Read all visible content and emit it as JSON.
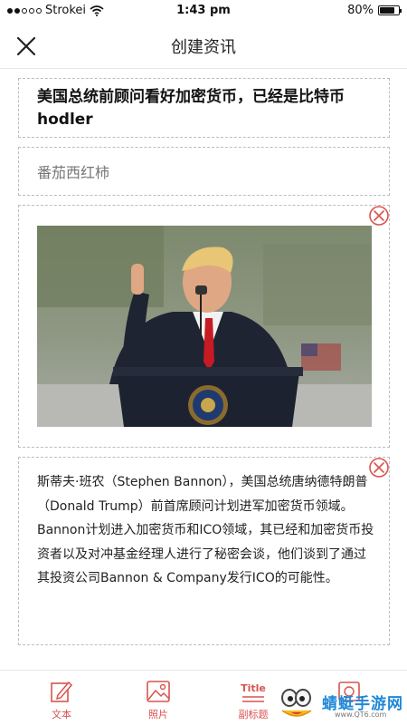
{
  "status_bar": {
    "carrier": "Strokei",
    "time": "1:43 pm",
    "battery": "80%",
    "battery_level": 0.8
  },
  "nav": {
    "title": "创建资讯",
    "close_icon": "close-icon"
  },
  "article": {
    "title": "美国总统前顾问看好加密货币，已经是比特币hodler",
    "subtitle": "番茄西红柿",
    "body": "斯蒂夫·班农（Stephen Bannon），美国总统唐纳德特朗普（Donald Trump）前首席顾问计划进军加密货币领域。Bannon计划进入加密货币和ICO领域，其已经和加密货币投资者以及对冲基金经理人进行了秘密会谈，他们谈到了通过其投资公司Bannon & Company发行ICO的可能性。"
  },
  "toolbar": {
    "items": [
      {
        "label": "文本",
        "icon": "edit-icon"
      },
      {
        "label": "照片",
        "icon": "photo-icon"
      },
      {
        "label": "副标题",
        "icon": "subtitle-icon",
        "icon_text": "Title"
      },
      {
        "label": "",
        "icon": "video-icon"
      }
    ]
  },
  "watermark": {
    "text": "蜻蜓手游网",
    "url": "www.QT6.com"
  },
  "colors": {
    "accent": "#d9534f",
    "border": "#bdbdbd",
    "watermark_blue": "#1e88d8"
  }
}
